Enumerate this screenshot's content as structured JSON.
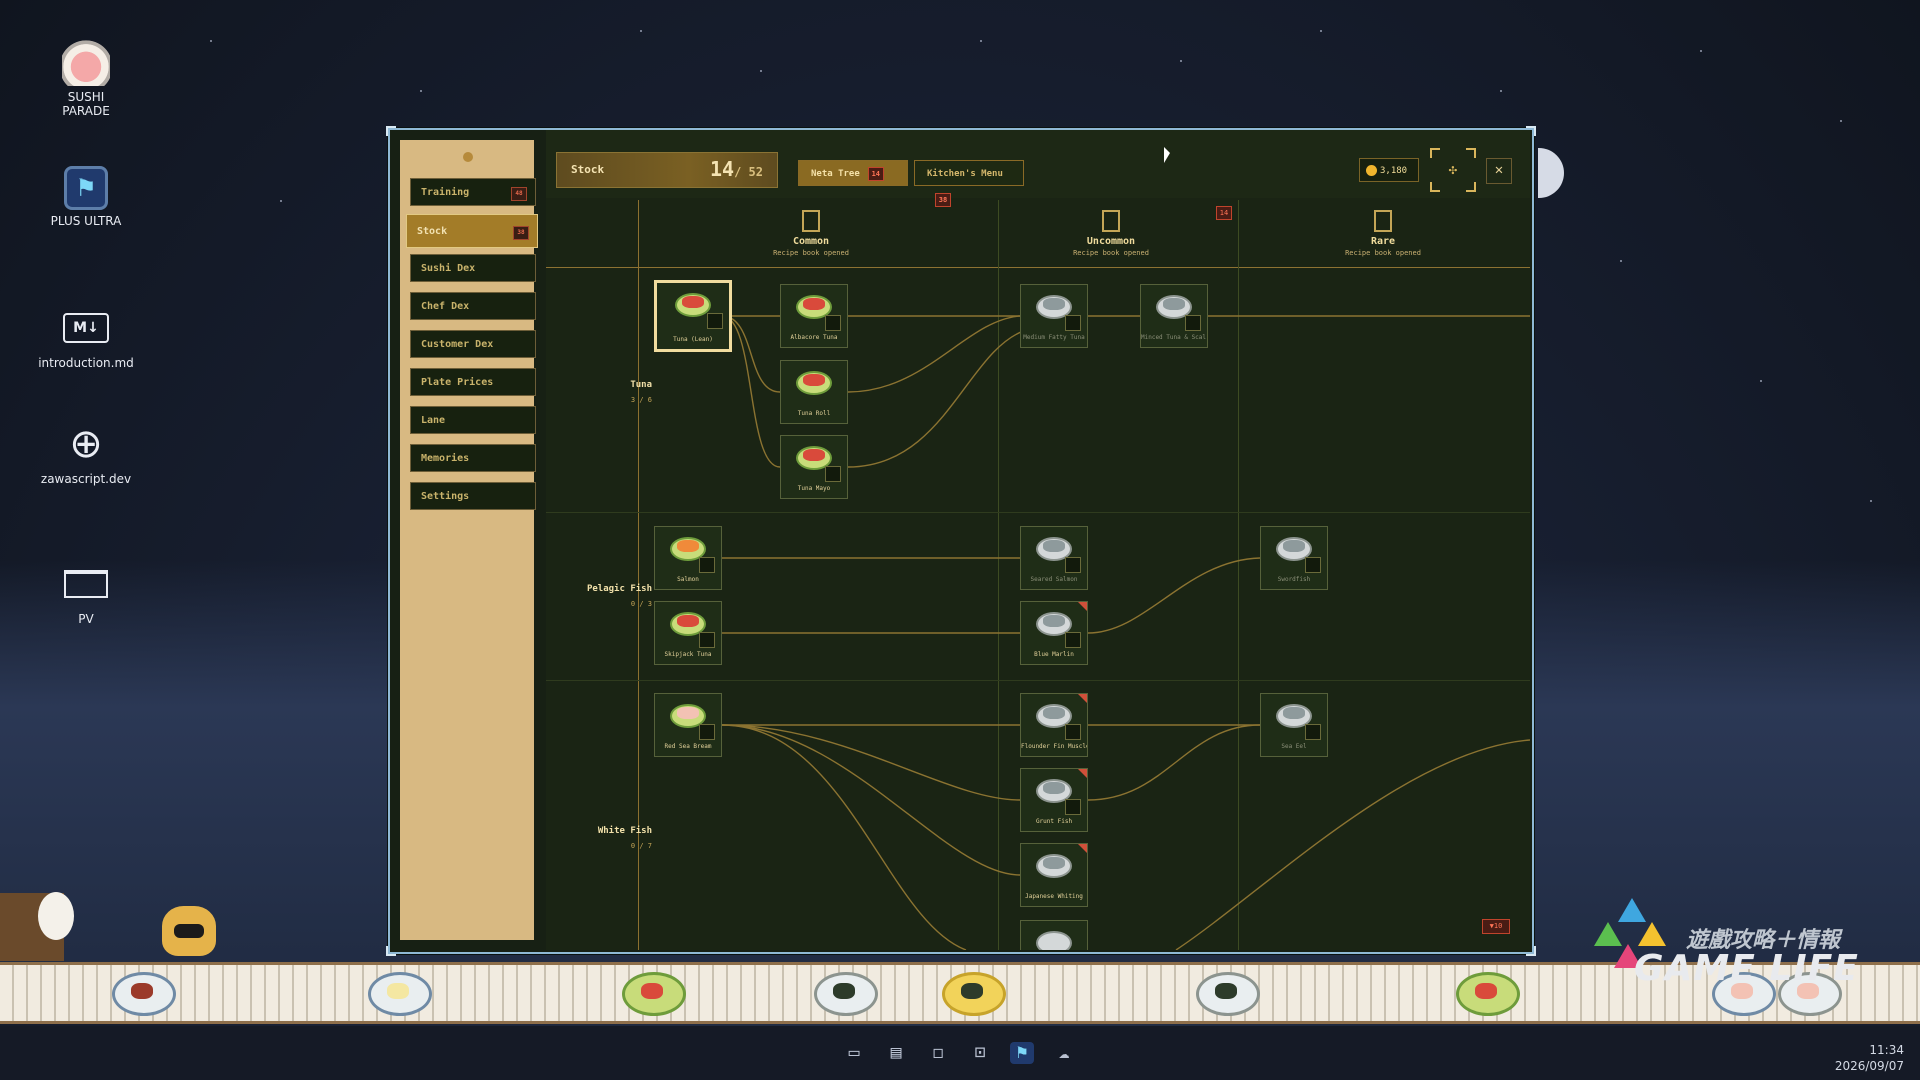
{
  "desktop": {
    "icons": [
      {
        "label": "SUSHI\nPARADE",
        "icon": "sushi-parade-icon"
      },
      {
        "label": "PLUS ULTRA",
        "icon": "plus-ultra-icon"
      },
      {
        "label": "introduction.md",
        "icon": "markdown-icon"
      },
      {
        "label": "zawascript.dev",
        "icon": "globe-icon"
      },
      {
        "label": "PV",
        "icon": "folder-icon"
      }
    ]
  },
  "sidebar": {
    "items": [
      {
        "label": "Training",
        "badge": "48"
      },
      {
        "label": "Stock",
        "badge": "38",
        "active": true
      },
      {
        "label": "Sushi Dex"
      },
      {
        "label": "Chef Dex"
      },
      {
        "label": "Customer Dex"
      },
      {
        "label": "Plate Prices"
      },
      {
        "label": "Lane"
      },
      {
        "label": "Memories"
      },
      {
        "label": "Settings"
      }
    ]
  },
  "header": {
    "stock_label": "Stock",
    "stock_count": "14",
    "stock_total": "/ 52",
    "tab_neta": "Neta Tree",
    "tab_neta_badge": "14",
    "tab_kitchen": "Kitchen's Menu",
    "tab_kitchen_badge": "38",
    "coins": "3,180",
    "close_glyph": "✕",
    "move_glyph": "✣"
  },
  "columns": [
    {
      "title": "Common",
      "subtitle": "Recipe book opened"
    },
    {
      "title": "Uncommon",
      "subtitle": "Recipe book opened",
      "badge": "14"
    },
    {
      "title": "Rare",
      "subtitle": "Recipe book opened"
    }
  ],
  "rows": [
    {
      "name": "Tuna",
      "count": "3 / 6"
    },
    {
      "name": "Pelagic Fish",
      "count": "0 / 3"
    },
    {
      "name": "White Fish",
      "count": "0 / 7"
    }
  ],
  "nodes": [
    {
      "name": "Tuna (Lean)",
      "colored": true,
      "selected": true
    },
    {
      "name": "Albacore Tuna",
      "colored": true
    },
    {
      "name": "Tuna Roll",
      "colored": true
    },
    {
      "name": "Tuna Mayo",
      "colored": true
    },
    {
      "name": "Medium Fatty Tuna"
    },
    {
      "name": "Minced Tuna & Scal..."
    },
    {
      "name": "Salmon",
      "colored": true
    },
    {
      "name": "Skipjack Tuna",
      "colored": true
    },
    {
      "name": "Seared Salmon"
    },
    {
      "name": "Blue Marlin",
      "flag": true
    },
    {
      "name": "Swordfish"
    },
    {
      "name": "Red Sea Bream",
      "colored": true
    },
    {
      "name": "Flounder Fin Muscle",
      "flag": true
    },
    {
      "name": "Grunt Fish",
      "flag": true
    },
    {
      "name": "Japanese Whiting",
      "flag": true
    },
    {
      "name": "Sea Eel"
    }
  ],
  "bottom_badge": "▼10",
  "colors": {
    "accent": "#a37c28",
    "panel": "#d8b982",
    "badge_red": "#c0442c",
    "bg_main": "#1a2414"
  },
  "watermark": {
    "line1": "遊戲攻略＋情報",
    "line2": "GAME LIFE"
  },
  "taskbar": {
    "icons": [
      "folder-icon",
      "window-icon",
      "chat-icon",
      "terminal-icon",
      "plus-ultra-icon",
      "ghost-icon"
    ],
    "time": "11:34",
    "date": "2026/09/07"
  }
}
